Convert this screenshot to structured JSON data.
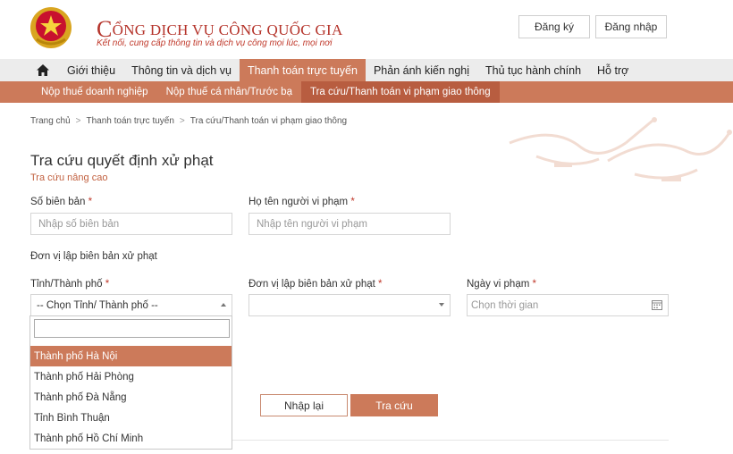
{
  "header": {
    "title_initial": "C",
    "title_rest": "ỔNG DỊCH VỤ CÔNG QUỐC GIA",
    "subtitle": "Kết nối, cung cấp thông tin và dịch vụ công mọi lúc, mọi nơi",
    "register_label": "Đăng ký",
    "login_label": "Đăng nhập"
  },
  "main_nav": {
    "items": [
      {
        "label": "Giới thiệu"
      },
      {
        "label": "Thông tin và dịch vụ"
      },
      {
        "label": "Thanh toán trực tuyến"
      },
      {
        "label": "Phản ánh kiến nghị"
      },
      {
        "label": "Thủ tục hành chính"
      },
      {
        "label": "Hỗ trợ"
      }
    ]
  },
  "sub_nav": {
    "items": [
      {
        "label": "Nộp thuế doanh nghiệp"
      },
      {
        "label": "Nộp thuế cá nhân/Trước bạ"
      },
      {
        "label": "Tra cứu/Thanh toán vi phạm giao thông"
      }
    ]
  },
  "breadcrumb": {
    "items": [
      "Trang chủ",
      "Thanh toán trực tuyến",
      "Tra cứu/Thanh toán vi phạm giao thông"
    ]
  },
  "form": {
    "title": "Tra cứu quyết định xử phạt",
    "advanced_link": "Tra cứu nâng cao",
    "record_no_label": "Số biên bản",
    "record_no_placeholder": "Nhập số biên bản",
    "violator_label": "Họ tên người vi phạm",
    "violator_placeholder": "Nhập tên người vi phạm",
    "required_mark": "*",
    "section_title": "Đơn vị lập biên bản xử phạt",
    "province_label": "Tỉnh/Thành phố",
    "province_value": "-- Chọn Tỉnh/ Thành phố --",
    "unit_label": "Đơn vị lập biên bản xử phạt",
    "unit_value": "",
    "date_label": "Ngày vi phạm",
    "date_placeholder": "Chọn thời gian",
    "reset_label": "Nhập lại",
    "search_label": "Tra cứu"
  },
  "dropdown": {
    "search_value": "",
    "options": [
      {
        "label": "Thành phố Hà Nội",
        "selected": true
      },
      {
        "label": "Thành phố Hải Phòng",
        "selected": false
      },
      {
        "label": "Thành phố Đà Nẵng",
        "selected": false
      },
      {
        "label": "Tỉnh Bình Thuận",
        "selected": false
      },
      {
        "label": "Thành phố Hồ Chí Minh",
        "selected": false
      }
    ]
  },
  "colors": {
    "accent": "#cc7a5a",
    "accent_dark": "#b85d40",
    "brand_red": "#b5342b",
    "nav_bg": "#ececec"
  }
}
